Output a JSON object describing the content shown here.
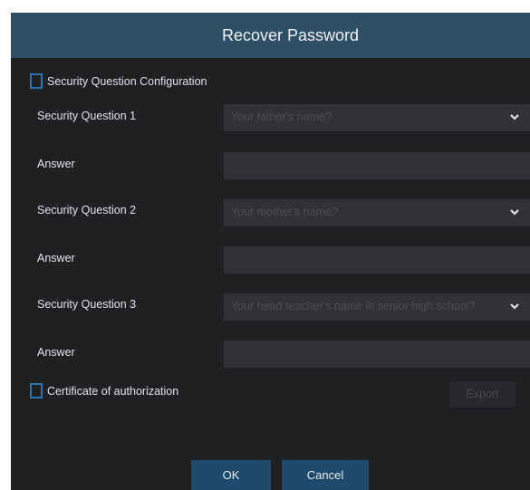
{
  "dialog": {
    "title": "Recover Password",
    "security_config": {
      "label": "Security Question Configuration",
      "checked": false
    },
    "questions": [
      {
        "label": "Security Question 1",
        "value": "Your father's name?"
      },
      {
        "label": "Security Question 2",
        "value": "Your mother's name?"
      },
      {
        "label": "Security Question 3",
        "value": "Your head teacher's name in senior high school?"
      }
    ],
    "answers": [
      {
        "label": "Answer",
        "value": ""
      },
      {
        "label": "Answer",
        "value": ""
      },
      {
        "label": "Answer",
        "value": ""
      }
    ],
    "certificate": {
      "label": "Certificate of authorization",
      "checked": false
    },
    "export_label": "Export",
    "ok_label": "OK",
    "cancel_label": "Cancel"
  },
  "colors": {
    "titlebar": "#2e4f66",
    "background": "#1e2022",
    "field": "#303235",
    "accent": "#2b74ad",
    "button": "#204a6b"
  },
  "icons": {
    "dropdown": "chevron-down-icon"
  }
}
